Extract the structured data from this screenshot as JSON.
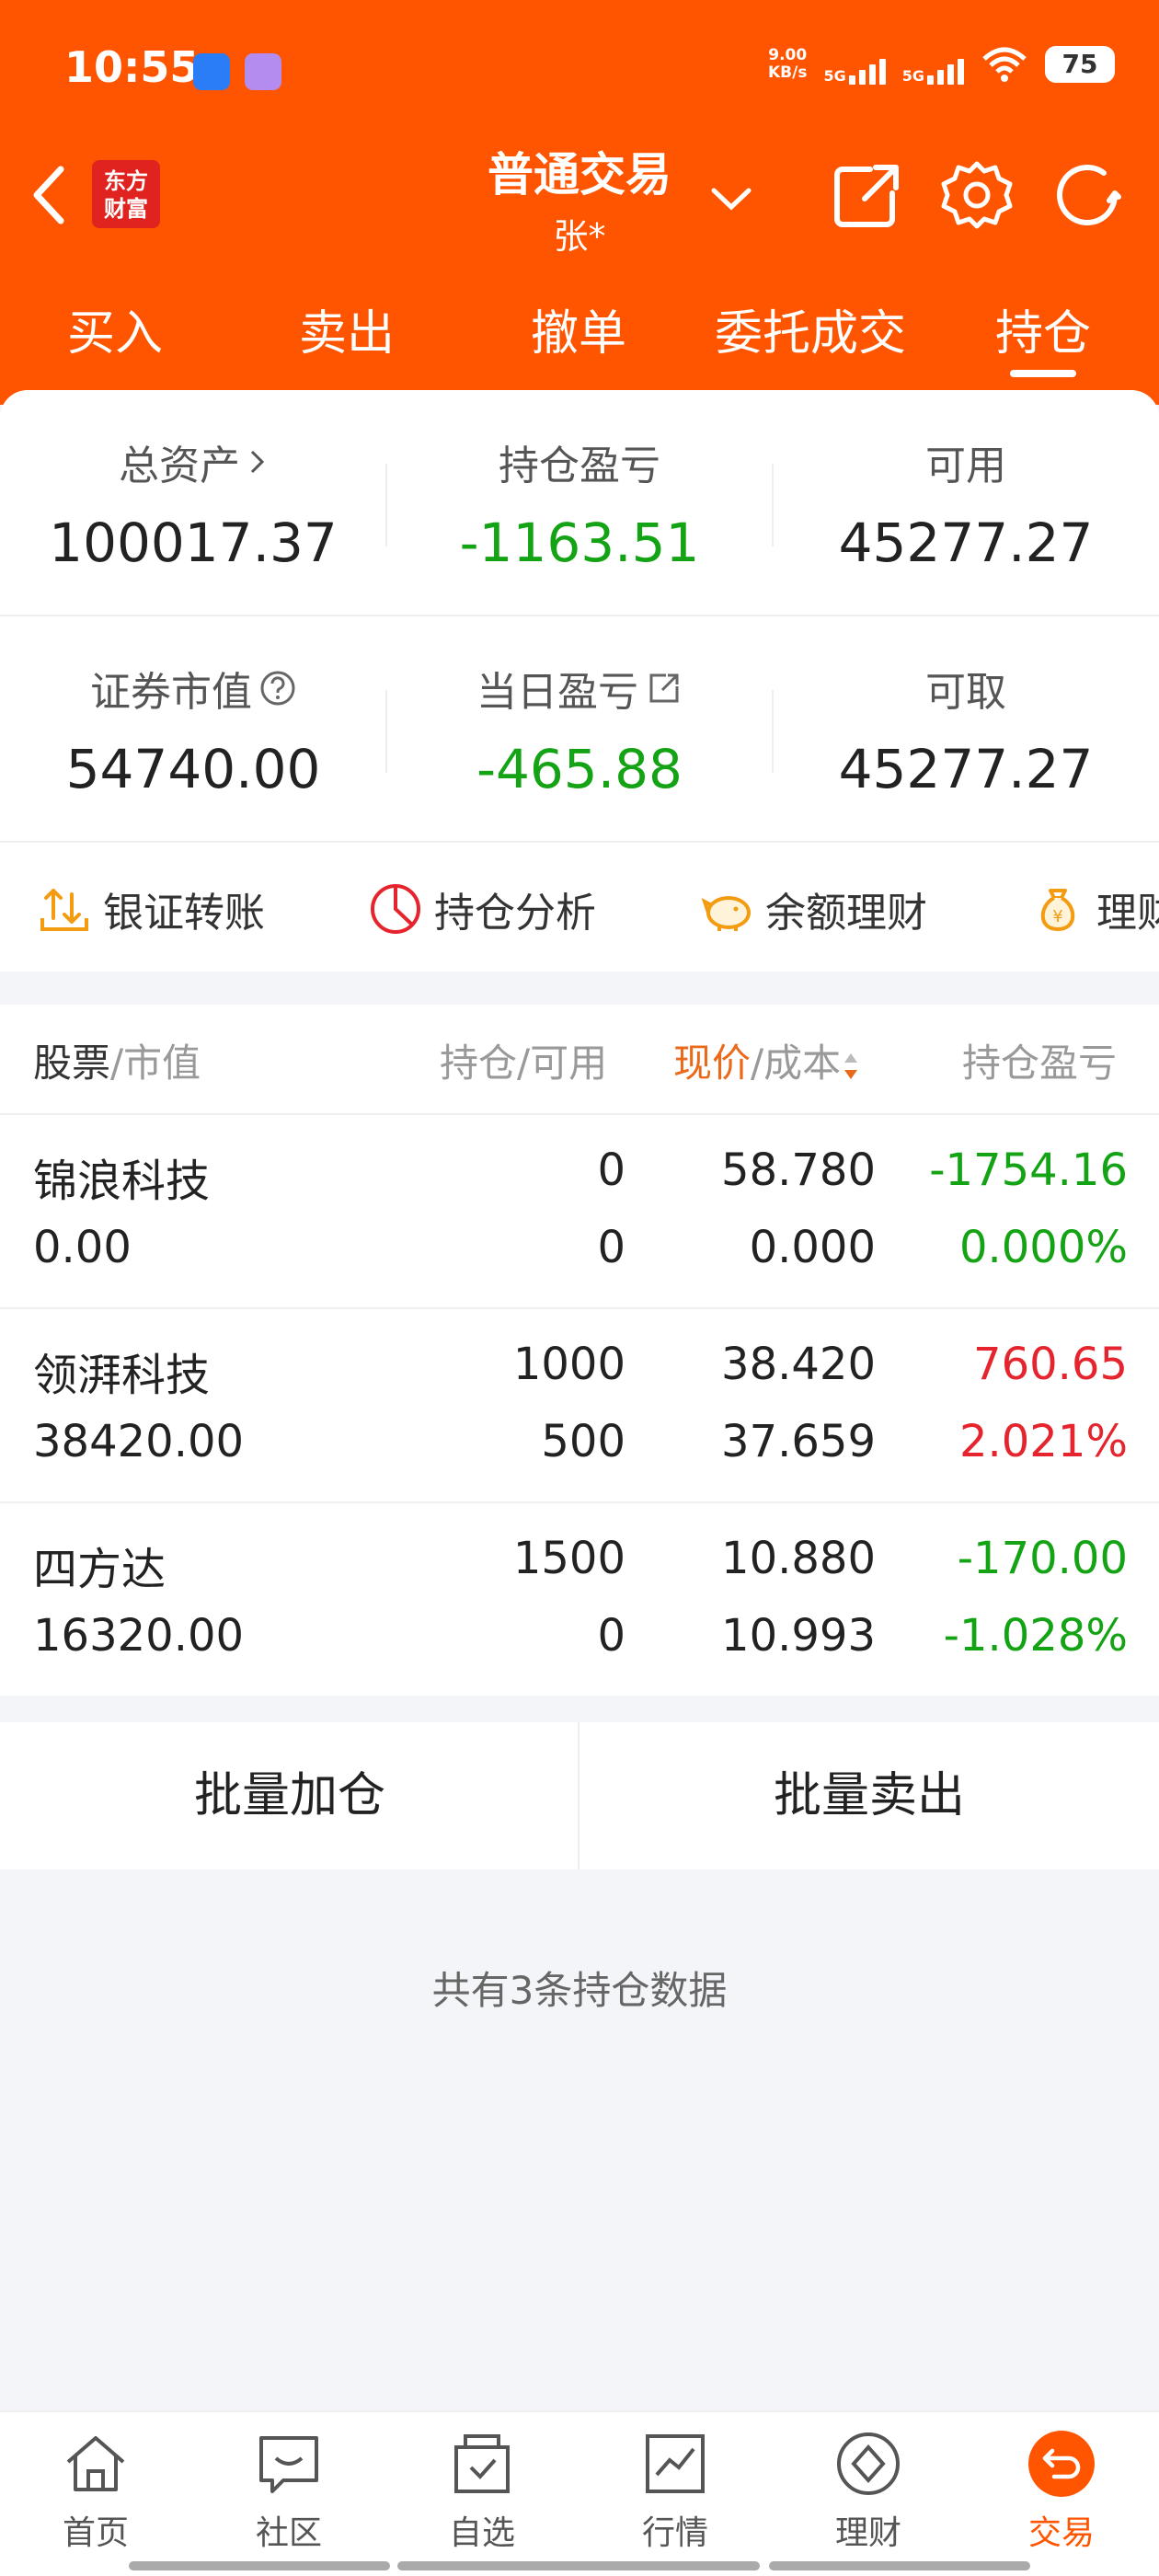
{
  "status": {
    "time": "10:55",
    "net_speed_top": "9.00",
    "net_speed_bottom": "KB/s",
    "sig1": "5G",
    "sig2": "5G",
    "battery": "75"
  },
  "nav": {
    "logo_line1": "东方",
    "logo_line2": "财富",
    "title": "普通交易",
    "subtitle": "张*"
  },
  "tabs": [
    "买入",
    "卖出",
    "撤单",
    "委托成交",
    "持仓"
  ],
  "summary": {
    "total_assets_label": "总资产",
    "total_assets": "100017.37",
    "position_pnl_label": "持仓盈亏",
    "position_pnl": "-1163.51",
    "available_label": "可用",
    "available": "45277.27",
    "market_value_label": "证券市值",
    "market_value": "54740.00",
    "daily_pnl_label": "当日盈亏",
    "daily_pnl": "-465.88",
    "withdrawable_label": "可取",
    "withdrawable": "45277.27"
  },
  "quick_actions": [
    "银证转账",
    "持仓分析",
    "余额理财",
    "理财"
  ],
  "table": {
    "col1_main": "股票",
    "col1_sub": "/市值",
    "col2": "持仓/可用",
    "col3_main": "现价",
    "col3_sub": "/成本",
    "col4": "持仓盈亏",
    "rows": [
      {
        "name": "锦浪科技",
        "value": "0.00",
        "hold": "0",
        "avail": "0",
        "price": "58.780",
        "cost": "0.000",
        "pnl": "-1754.16",
        "pct": "0.000%"
      },
      {
        "name": "领湃科技",
        "value": "38420.00",
        "hold": "1000",
        "avail": "500",
        "price": "38.420",
        "cost": "37.659",
        "pnl": "760.65",
        "pct": "2.021%"
      },
      {
        "name": "四方达",
        "value": "16320.00",
        "hold": "1500",
        "avail": "0",
        "price": "10.880",
        "cost": "10.993",
        "pnl": "-170.00",
        "pct": "-1.028%"
      }
    ]
  },
  "batch": {
    "add": "批量加仓",
    "sell": "批量卖出"
  },
  "footer_note": "共有3条持仓数据",
  "bottom_nav": [
    "首页",
    "社区",
    "自选",
    "行情",
    "理财",
    "交易"
  ],
  "colors": {
    "brand": "#ff5500",
    "up": "#e5242d",
    "down": "#14a314"
  }
}
